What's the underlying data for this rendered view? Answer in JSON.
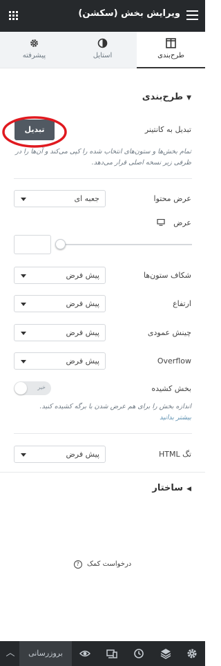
{
  "header": {
    "title": "ویرایش بخش (سکشن)"
  },
  "tabs": [
    {
      "label": "طرح‌بندی",
      "icon": "columns-icon"
    },
    {
      "label": "استایل",
      "icon": "half-circle-icon"
    },
    {
      "label": "پیشرفته",
      "icon": "gear-icon"
    }
  ],
  "layout_section": {
    "title": "طرح‌بندی",
    "convert_label": "تبدیل به کانتینر",
    "convert_button": "تبدیل",
    "convert_desc": "تمام بخش‌ها و ستون‌های انتخاب شده را کپی می‌کند و آن‌ها را در ظرفی زیر نسخه اصلی قرار می‌دهد.",
    "content_width": {
      "label": "عرض محتوا",
      "value": "جعبه ای"
    },
    "width": {
      "label": "عرض",
      "slider_value": 0
    },
    "column_gap": {
      "label": "شکاف ستون‌ها",
      "value": "پیش فرض"
    },
    "height": {
      "label": "ارتفاع",
      "value": "پیش فرض"
    },
    "vertical_align": {
      "label": "چینش عمودی",
      "value": "پیش فرض"
    },
    "overflow": {
      "label": "Overflow",
      "value": "پیش فرض"
    },
    "stretch": {
      "label": "بخش کشیده",
      "toggle": "خیر",
      "desc": "اندازه بخش را برای هم عرض شدن با برگه کشیده کنید.",
      "link": "بیشتر بدانید"
    },
    "html_tag": {
      "label": "تگ HTML",
      "value": "پیش فرض"
    }
  },
  "structure_section": {
    "title": "ساختار"
  },
  "help": {
    "label": "درخواست کمک"
  },
  "footer": {
    "update_button": "بروزرسانی"
  },
  "colors": {
    "header_bg": "#26292c",
    "button_bg": "#515962",
    "link": "#5b8fb0",
    "highlight_circle": "#e0191f"
  }
}
